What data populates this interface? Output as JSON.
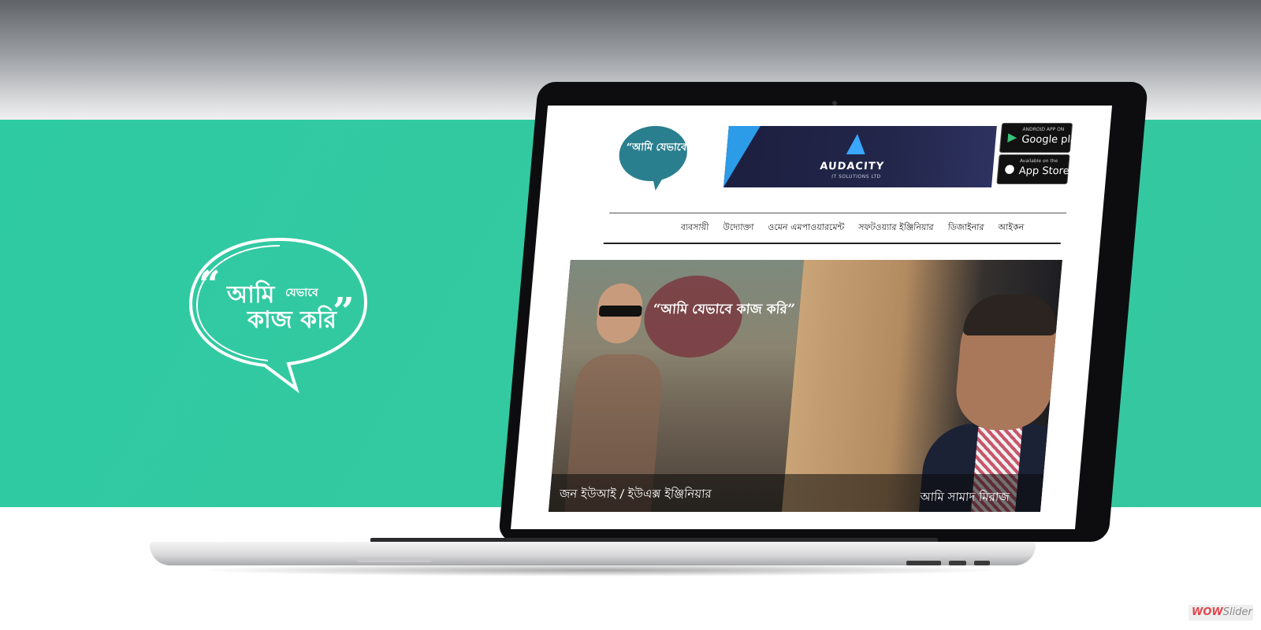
{
  "brand": {
    "logo_text_main": "“আমি",
    "logo_text_small": "যেভাবে",
    "logo_text_line2": "কাজ করি”",
    "quote_open": "“",
    "quote_close": "”",
    "line1": "আমি",
    "line2": "কাজ করি"
  },
  "site": {
    "logo_text": "“আমি যেভাবে কাজ করি”",
    "banner": {
      "name": "AUDACITY",
      "subtitle": "IT SOLUTIONS LTD"
    },
    "stores": [
      {
        "small": "ANDROID APP ON",
        "big": "Google play",
        "icon": "play-icon"
      },
      {
        "small": "Available on the",
        "big": "App Store",
        "icon": "apple-icon"
      }
    ],
    "nav": [
      "ব্যবসায়ী",
      "উদ্যোক্তা",
      "ওমেন এমপাওয়ারমেন্ট",
      "সফটওয়্যার ইঞ্জিনিয়ার",
      "ডিজাইনার",
      "আইকন"
    ],
    "slider": {
      "overlay_logo": "“আমি যেভাবে কাজ করি”",
      "caption_left": "জন ইউআই / ইউএক্স ইঞ্জিনিয়ার",
      "caption_right": "আমি সামাদ মিরাজ"
    }
  },
  "watermark": {
    "part1": "WOW",
    "part2": "Slider"
  },
  "colors": {
    "accent_green": "#33c9a1",
    "logo_teal": "#2a7f8e",
    "overlay_maroon": "#7b3f44"
  }
}
